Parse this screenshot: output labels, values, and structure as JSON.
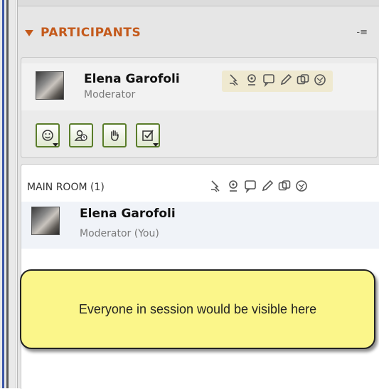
{
  "panel": {
    "title": "PARTICIPANTS",
    "accent_color": "#c45a1c",
    "menu_icon": "list-menu-icon"
  },
  "current_user": {
    "name": "Elena Garofoli",
    "role": "Moderator",
    "status_icons": [
      "presenter-icon",
      "webcam-icon",
      "chat-bubble-icon",
      "pencil-icon",
      "share-window-icon",
      "globe-icon"
    ]
  },
  "tool_buttons": [
    {
      "name": "emoticon-button",
      "icon": "smiley-icon",
      "has_dropdown": true
    },
    {
      "name": "away-button",
      "icon": "away-clock-icon",
      "has_dropdown": false
    },
    {
      "name": "raise-hand-button",
      "icon": "hand-icon",
      "has_dropdown": false
    },
    {
      "name": "poll-button",
      "icon": "checkbox-icon",
      "has_dropdown": true
    }
  ],
  "main_room": {
    "title": "MAIN ROOM (1)",
    "participants": [
      {
        "name": "Elena Garofoli",
        "role": "Moderator (You)"
      }
    ]
  },
  "callout": {
    "text": "Everyone in session would be visible here",
    "fill_color": "#fbf68a"
  }
}
